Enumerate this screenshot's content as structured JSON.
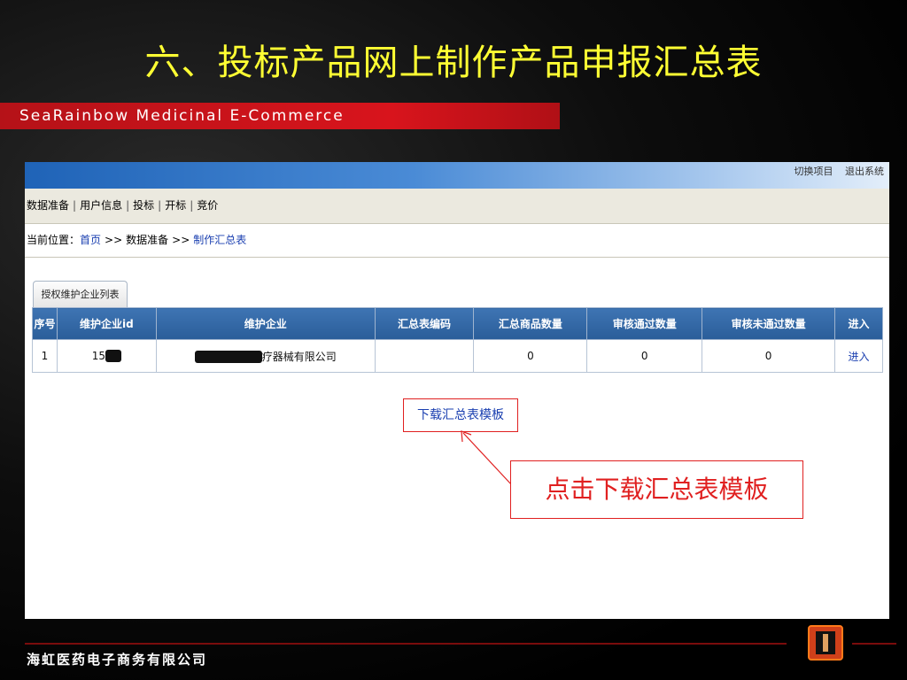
{
  "slide": {
    "title": "六、投标产品网上制作产品申报汇总表",
    "brand": "SeaRainbow  Medicinal  E-Commerce",
    "company": "海虹医药电子商务有限公司",
    "callout": "点击下载汇总表模板"
  },
  "app": {
    "top_links": [
      "切换项目",
      "退出系统"
    ],
    "nav_menu": [
      "数据准备",
      "用户信息",
      "投标",
      "开标",
      "竞价"
    ],
    "breadcrumb": {
      "prefix": "当前位置：",
      "items": [
        "首页",
        "数据准备",
        "制作汇总表"
      ],
      "separator": ">>"
    },
    "tab_label": "授权维护企业列表",
    "table": {
      "headers": [
        "序号",
        "维护企业id",
        "维护企业",
        "汇总表编码",
        "汇总商品数量",
        "审核通过数量",
        "审核未通过数量",
        "进入"
      ],
      "rows": [
        {
          "index": "1",
          "company_id": "15",
          "company_name": "疗器械有限公司",
          "summary_code": "",
          "product_count": "0",
          "approved": "0",
          "rejected": "0",
          "enter": "进入"
        }
      ]
    },
    "download_button": "下载汇总表模板"
  },
  "colors": {
    "title": "#ffff33",
    "brand_bar": "#d8141c",
    "header_blue": "#2a5d99",
    "link_blue": "#1a3fb0",
    "callout_red": "#e02020"
  }
}
